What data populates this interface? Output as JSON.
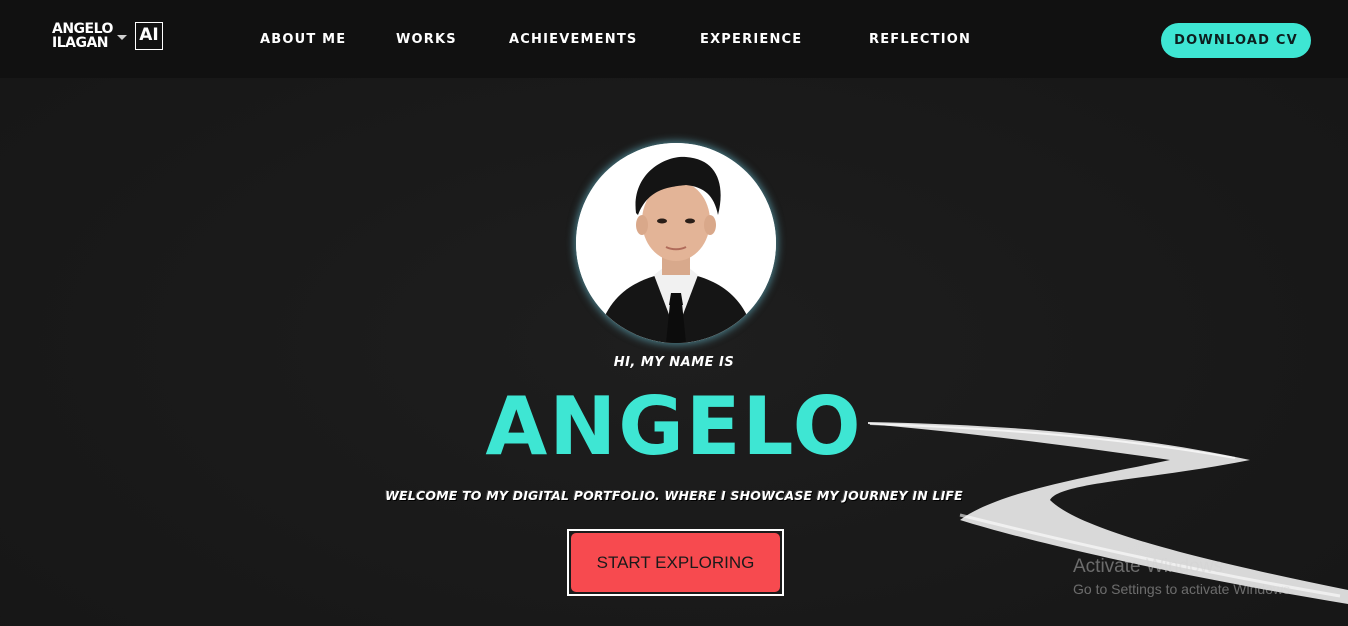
{
  "logo": {
    "line1": "ANGELO",
    "line2": "ILAGAN",
    "badge": "AI"
  },
  "nav": {
    "items": [
      {
        "label": "ABOUT ME"
      },
      {
        "label": "WORKS"
      },
      {
        "label": "ACHIEVEMENTS"
      },
      {
        "label": "EXPERIENCE"
      },
      {
        "label": "REFLECTION"
      }
    ],
    "cta_label": "DOWNLOAD CV"
  },
  "hero": {
    "greeting": "HI, MY NAME IS",
    "name": "ANGELO",
    "tagline": "WELCOME TO MY DIGITAL PORTFOLIO. WHERE I SHOWCASE MY JOURNEY IN LIFE",
    "button_label": "START EXPLORING"
  },
  "watermark": {
    "title": "Activate Windows",
    "subtitle": "Go to Settings to activate Windows."
  },
  "colors": {
    "accent": "#3ee6d3",
    "button": "#f74a4f",
    "background": "#1b1b1b",
    "navbar": "#111111"
  }
}
